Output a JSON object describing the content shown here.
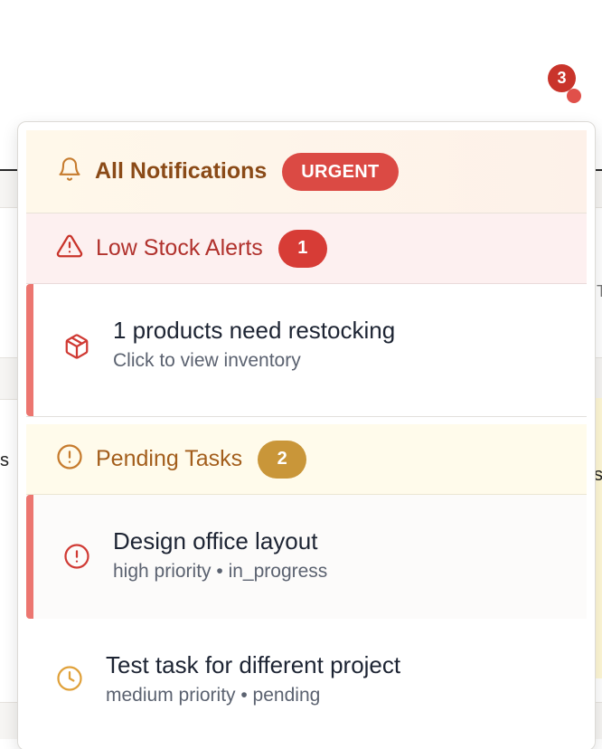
{
  "bell": {
    "count": "3"
  },
  "background": {
    "left_fragment": "s",
    "right_fragment": "s",
    "right_fragment2": "T"
  },
  "notifications": {
    "title": "All Notifications",
    "urgent_label": "URGENT",
    "low_stock": {
      "label": "Low Stock Alerts",
      "count": "1",
      "items": [
        {
          "title": "1 products need restocking",
          "subtitle": "Click to view inventory",
          "icon": "package-icon"
        }
      ]
    },
    "pending_tasks": {
      "label": "Pending Tasks",
      "count": "2",
      "items": [
        {
          "title": "Design office layout",
          "subtitle": "high priority • in_progress",
          "icon": "alert-circle-icon"
        },
        {
          "title": "Test task for different project",
          "subtitle": "medium priority • pending",
          "icon": "clock-icon"
        }
      ]
    }
  },
  "colors": {
    "urgent": "#db4a44",
    "stock_badge": "#d73c36",
    "tasks_badge": "#c99639",
    "accent_bar": "#ec7670",
    "bell_badge": "#c9342b"
  }
}
